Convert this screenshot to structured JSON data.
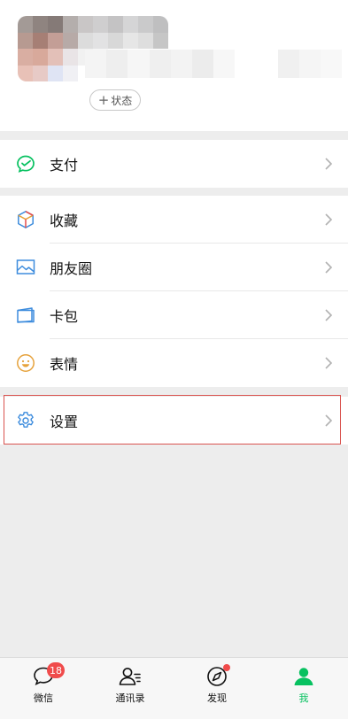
{
  "profile": {
    "status_button": "状态",
    "status_plus": "+"
  },
  "menu": {
    "pay": {
      "label": "支付",
      "icon": "pay-icon"
    },
    "favorites": {
      "label": "收藏",
      "icon": "favorites-cube-icon"
    },
    "moments": {
      "label": "朋友圈",
      "icon": "moments-image-icon"
    },
    "cards": {
      "label": "卡包",
      "icon": "card-wallet-icon"
    },
    "stickers": {
      "label": "表情",
      "icon": "smiley-face-icon"
    },
    "settings": {
      "label": "设置",
      "icon": "gear-icon"
    }
  },
  "tabbar": {
    "chats": {
      "label": "微信",
      "badge": "18",
      "icon": "chat-bubble-icon"
    },
    "contacts": {
      "label": "通讯录",
      "icon": "contacts-icon"
    },
    "discover": {
      "label": "发现",
      "icon": "compass-icon"
    },
    "me": {
      "label": "我",
      "icon": "person-icon"
    }
  },
  "colors": {
    "accent_green": "#07c160",
    "badge_red": "#f04b4b",
    "highlight_red": "#d9534f",
    "background": "#ededed"
  }
}
